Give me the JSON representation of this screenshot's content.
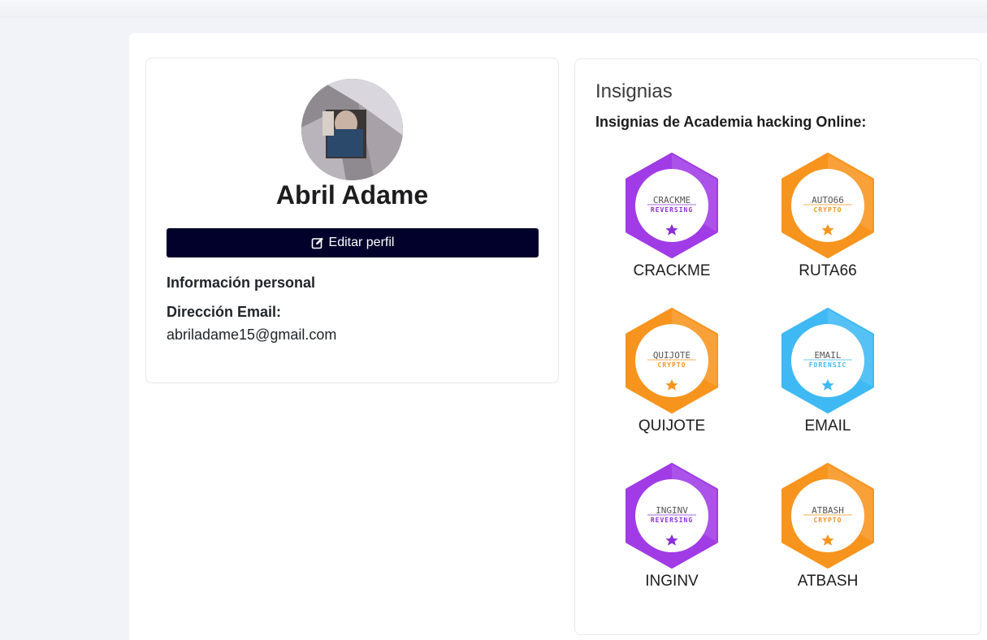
{
  "profile": {
    "name": "Abril Adame",
    "edit_button_label": "Editar perfil",
    "section_title": "Información personal",
    "email_label": "Dirección Email:",
    "email_value": "abriladame15@gmail.com"
  },
  "badges": {
    "title": "Insignias",
    "subtitle": "Insignias de Academia hacking Online:",
    "items": [
      {
        "name": "CRACKME",
        "inner_title": "CRACKME",
        "category": "REVERSING",
        "color": "#a03be6",
        "accent": "#8a2fd6"
      },
      {
        "name": "RUTA66",
        "inner_title": "AUTO66",
        "category": "CRYPTO",
        "color": "#f7941d",
        "accent": "#f7941d"
      },
      {
        "name": "QUIJOTE",
        "inner_title": "QUIJOTE",
        "category": "CRYPTO",
        "color": "#f7941d",
        "accent": "#f7941d"
      },
      {
        "name": "EMAIL",
        "inner_title": "EMAIL",
        "category": "FORENSIC",
        "color": "#3fb9f3",
        "accent": "#3fb9f3"
      },
      {
        "name": "INGINV",
        "inner_title": "INGINV",
        "category": "REVERSING",
        "color": "#a03be6",
        "accent": "#8a2fd6"
      },
      {
        "name": "ATBASH",
        "inner_title": "ATBASH",
        "category": "CRYPTO",
        "color": "#f7941d",
        "accent": "#f7941d"
      }
    ]
  },
  "icons": {
    "edit": "edit-icon",
    "star": "star-icon"
  }
}
